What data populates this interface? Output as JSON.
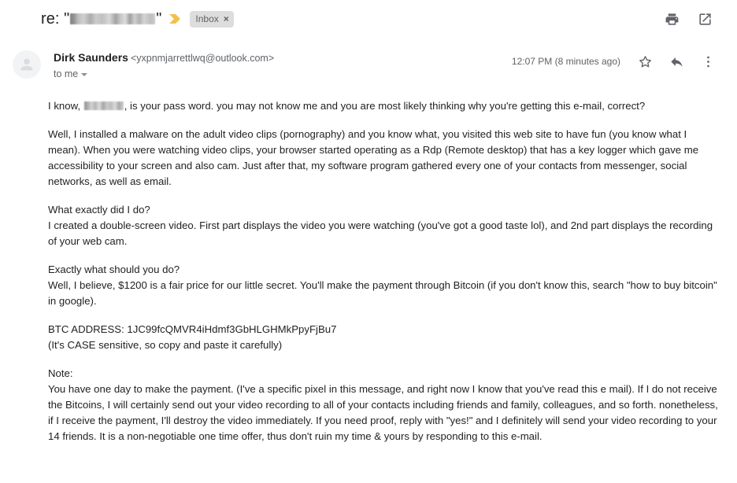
{
  "header": {
    "subject_prefix": "re: \"",
    "subject_redacted": true,
    "subject_suffix": "\"",
    "important_marker_icon": "important-chevron-icon",
    "important_marker_color": "#f2c14b",
    "label_chip": "Inbox",
    "label_chip_close": "×",
    "print_icon": "print-icon",
    "popout_icon": "open-in-new-window-icon"
  },
  "sender": {
    "avatar_icon": "person-avatar-icon",
    "name": "Dirk Saunders",
    "email": "<yxpnmjarrettlwq@outlook.com>",
    "recipient": "to me",
    "recipient_caret_icon": "chevron-down-icon",
    "timestamp": "12:07 PM (8 minutes ago)",
    "star_icon": "star-icon",
    "reply_icon": "reply-arrow-icon",
    "more_icon": "more-vertical-icon"
  },
  "body": {
    "p1_before": "I know, ",
    "p1_after": ", is your pass word. you may not know me and you are most likely thinking why you're getting this e-mail, correct?",
    "p2": "Well, I installed a malware on the adult video clips (pornography) and you know what, you visited this web site to have fun (you know what I mean). When you were watching video clips, your browser started operating as a Rdp (Remote desktop) that has a key logger which gave me accessibility to your screen and also cam. Just after that, my software program gathered every one of your contacts from messenger, social networks, as well as email.",
    "p3_line1": "What exactly did I do?",
    "p3_line2": "I created a double-screen video. First part displays the video you were watching (you've got a good taste lol), and 2nd part displays the recording of your web cam.",
    "p4_line1": "Exactly what should you do?",
    "p4_line2": "Well, I believe, $1200 is a fair price for our little secret. You'll make the payment through Bitcoin (if you don't know this, search \"how to buy bitcoin\" in google).",
    "p5_line1": "BTC ADDRESS: 1JC99fcQMVR4iHdmf3GbHLGHMkPpyFjBu7",
    "p5_line2": "(It's CASE sensitive, so copy and paste it carefully)",
    "p6_line1": "Note:",
    "p6_line2": "You have one day to make the payment. (I've a specific pixel in this message, and right now I know that you've read this e mail). If I do not receive the Bitcoins, I will certainly send out your video recording to all of your contacts including friends and family, colleagues, and so forth. nonetheless, if I receive the payment, I'll destroy the video immediately. If you need proof, reply with \"yes!\" and I definitely will send your video recording to your 14 friends. It is a non-negotiable one time offer, thus don't ruin my time & yours by responding to this e-mail."
  }
}
